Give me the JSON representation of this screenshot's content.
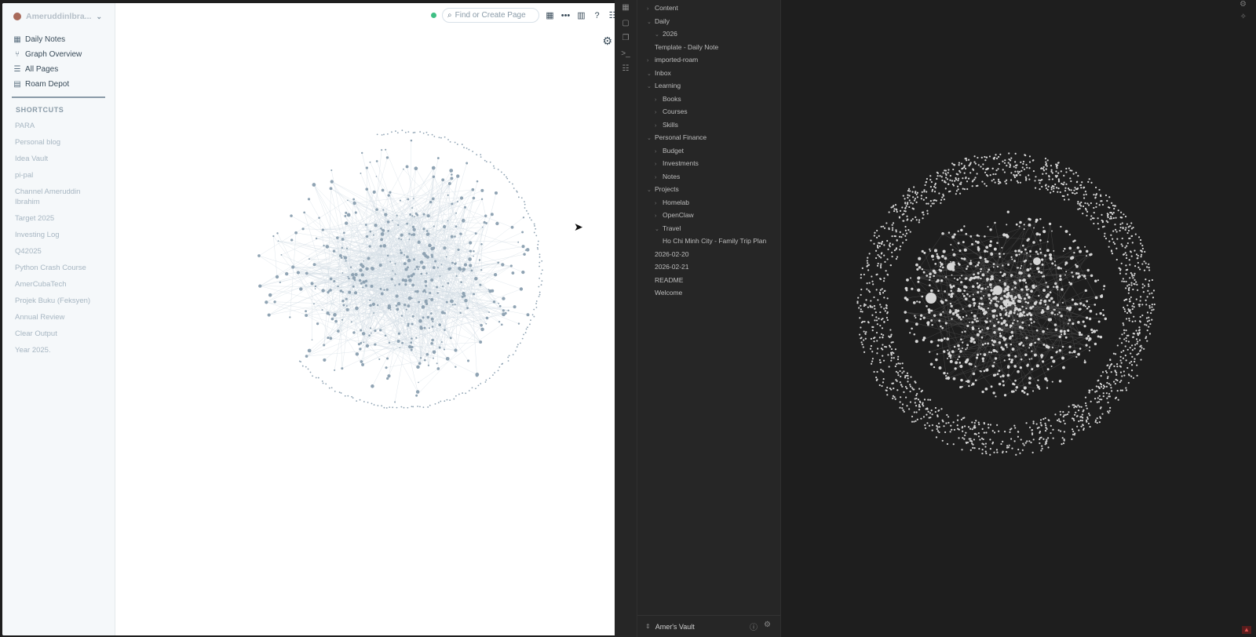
{
  "roam": {
    "user_name": "Ameruddinlbra...",
    "nav": [
      {
        "label": "Daily Notes",
        "icon": "calendar-icon"
      },
      {
        "label": "Graph Overview",
        "icon": "graph-icon"
      },
      {
        "label": "All Pages",
        "icon": "list-icon"
      },
      {
        "label": "Roam Depot",
        "icon": "store-icon"
      }
    ],
    "shortcuts_title": "SHORTCUTS",
    "shortcuts": [
      "PARA",
      "Personal blog",
      "Idea Vault",
      "pi-pal",
      "Channel Ameruddin Ibrahim",
      "Target 2025",
      "Investing Log",
      "Q42025",
      "Python Crash Course",
      "AmerCubaTech",
      "Projek Buku (Feksyen)",
      "Annual Review",
      "Clear Output",
      "Year 2025."
    ],
    "search_placeholder": "Find or Create Page",
    "status_color": "#3fbf84"
  },
  "obsidian": {
    "tree": [
      {
        "label": "Content",
        "level": 0,
        "arrow": "collapsed"
      },
      {
        "label": "Daily",
        "level": 0,
        "arrow": "expanded"
      },
      {
        "label": "2026",
        "level": 1,
        "arrow": "expanded"
      },
      {
        "label": "Template - Daily Note",
        "level": 1,
        "arrow": "none"
      },
      {
        "label": "imported-roam",
        "level": 0,
        "arrow": "collapsed"
      },
      {
        "label": "Inbox",
        "level": 0,
        "arrow": "expanded"
      },
      {
        "label": "Learning",
        "level": 0,
        "arrow": "expanded"
      },
      {
        "label": "Books",
        "level": 1,
        "arrow": "collapsed"
      },
      {
        "label": "Courses",
        "level": 1,
        "arrow": "collapsed"
      },
      {
        "label": "Skills",
        "level": 1,
        "arrow": "collapsed"
      },
      {
        "label": "Personal Finance",
        "level": 0,
        "arrow": "expanded"
      },
      {
        "label": "Budget",
        "level": 1,
        "arrow": "collapsed"
      },
      {
        "label": "Investments",
        "level": 1,
        "arrow": "collapsed"
      },
      {
        "label": "Notes",
        "level": 1,
        "arrow": "collapsed"
      },
      {
        "label": "Projects",
        "level": 0,
        "arrow": "expanded"
      },
      {
        "label": "Homelab",
        "level": 1,
        "arrow": "collapsed"
      },
      {
        "label": "OpenClaw",
        "level": 1,
        "arrow": "collapsed"
      },
      {
        "label": "Travel",
        "level": 1,
        "arrow": "expanded"
      },
      {
        "label": "Ho Chi Minh City - Family Trip Plan",
        "level": 2,
        "arrow": "none"
      },
      {
        "label": "2026-02-20",
        "level": 0,
        "arrow": "none"
      },
      {
        "label": "2026-02-21",
        "level": 0,
        "arrow": "none"
      },
      {
        "label": "README",
        "level": 0,
        "arrow": "none"
      },
      {
        "label": "Welcome",
        "level": 0,
        "arrow": "none"
      }
    ],
    "vault_name": "Amer's Vault"
  }
}
